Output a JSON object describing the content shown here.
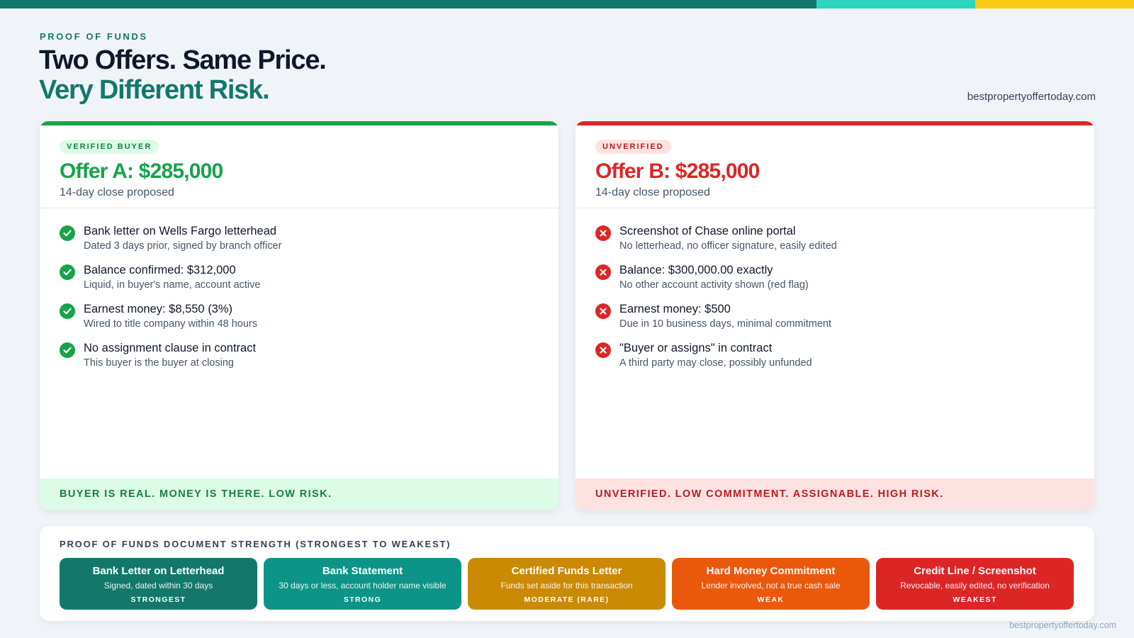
{
  "header": {
    "eyebrow": "PROOF OF FUNDS",
    "title_line1": "Two Offers. Same Price.",
    "title_line2": "Very Different Risk.",
    "site": "bestpropertyoffertoday.com"
  },
  "offer_a": {
    "badge": "VERIFIED BUYER",
    "title": "Offer A: $285,000",
    "subtitle": "14-day close proposed",
    "status_icon": "check-circle-icon",
    "items": [
      {
        "main": "Bank letter on Wells Fargo letterhead",
        "sub": "Dated 3 days prior, signed by branch officer"
      },
      {
        "main": "Balance confirmed: $312,000",
        "sub": "Liquid, in buyer's name, account active"
      },
      {
        "main": "Earnest money: $8,550 (3%)",
        "sub": "Wired to title company within 48 hours"
      },
      {
        "main": "No assignment clause in contract",
        "sub": "This buyer is the buyer at closing"
      }
    ],
    "footer": "BUYER IS REAL. MONEY IS THERE. LOW RISK.",
    "accent_color": "#16a34a"
  },
  "offer_b": {
    "badge": "UNVERIFIED",
    "title": "Offer B: $285,000",
    "subtitle": "14-day close proposed",
    "status_icon": "x-circle-icon",
    "items": [
      {
        "main": "Screenshot of Chase online portal",
        "sub": "No letterhead, no officer signature, easily edited"
      },
      {
        "main": "Balance: $300,000.00 exactly",
        "sub": "No other account activity shown (red flag)"
      },
      {
        "main": "Earnest money: $500",
        "sub": "Due in 10 business days, minimal commitment"
      },
      {
        "main": "\"Buyer or assigns\" in contract",
        "sub": "A third party may close, possibly unfunded"
      }
    ],
    "footer": "UNVERIFIED. LOW COMMITMENT. ASSIGNABLE. HIGH RISK.",
    "accent_color": "#dc2626"
  },
  "strength": {
    "title": "PROOF OF FUNDS DOCUMENT STRENGTH (STRONGEST TO WEAKEST)",
    "tiles": [
      {
        "title": "Bank Letter on Letterhead",
        "desc": "Signed, dated within 30 days",
        "level": "STRONGEST",
        "color": "#13786b"
      },
      {
        "title": "Bank Statement",
        "desc": "30 days or less, account holder name visible",
        "level": "STRONG",
        "color": "#0d9488"
      },
      {
        "title": "Certified Funds Letter",
        "desc": "Funds set aside for this transaction",
        "level": "MODERATE (RARE)",
        "color": "#ca8a04"
      },
      {
        "title": "Hard Money Commitment",
        "desc": "Lender involved, not a true cash sale",
        "level": "WEAK",
        "color": "#ea580c"
      },
      {
        "title": "Credit Line / Screenshot",
        "desc": "Revocable, easily edited, no verification",
        "level": "WEAKEST",
        "color": "#dc2626"
      }
    ]
  },
  "footer_site": "bestpropertyoffertoday.com",
  "colors": {
    "brand_teal": "#13786b",
    "topbar": [
      "#13786b",
      "#2dd4bf",
      "#facc15"
    ]
  }
}
